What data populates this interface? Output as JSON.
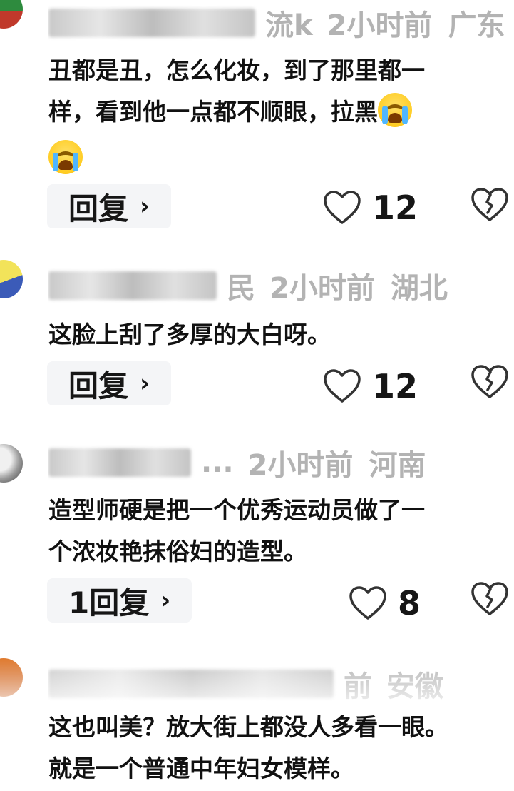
{
  "comments": [
    {
      "name_suffix": "流k",
      "time": "2小时前",
      "region": "广东",
      "text_lines": [
        "丑都是丑，怎么化妆，到了那里都一",
        "样，看到他一点都不顺眼，拉黑"
      ],
      "reply_label": "回复",
      "likes": "12",
      "avatar_colors": [
        "#2e8b3e",
        "#c0392b"
      ]
    },
    {
      "name_suffix": "民",
      "time": "2小时前",
      "region": "湖北",
      "text_lines": [
        "这脸上刮了多厚的大白呀。"
      ],
      "reply_label": "回复",
      "likes": "12",
      "avatar_colors": [
        "#f2e35a",
        "#3b5bb8"
      ]
    },
    {
      "name_suffix": "...",
      "time": "2小时前",
      "region": "河南",
      "text_lines": [
        "造型师硬是把一个优秀运动员做了一",
        "个浓妆艳抹俗妇的造型。"
      ],
      "reply_label": "1回复",
      "likes": "8",
      "avatar_colors": [
        "#d8d8d8",
        "#555555"
      ]
    },
    {
      "name_suffix": "前",
      "time": "",
      "region": "安徽",
      "text_lines": [
        "这也叫美？放大街上都没人多看一眼。",
        "就是一个普通中年妇女模样。"
      ],
      "avatar_colors": [
        "#e07a2e",
        "#c85a18"
      ]
    }
  ],
  "icons": {
    "like": "heart-outline-icon",
    "dislike": "broken-heart-icon",
    "reply_chevron": "chevron-right-icon",
    "emoji": "crying-emoji-icon"
  },
  "reply_chevron": "›"
}
